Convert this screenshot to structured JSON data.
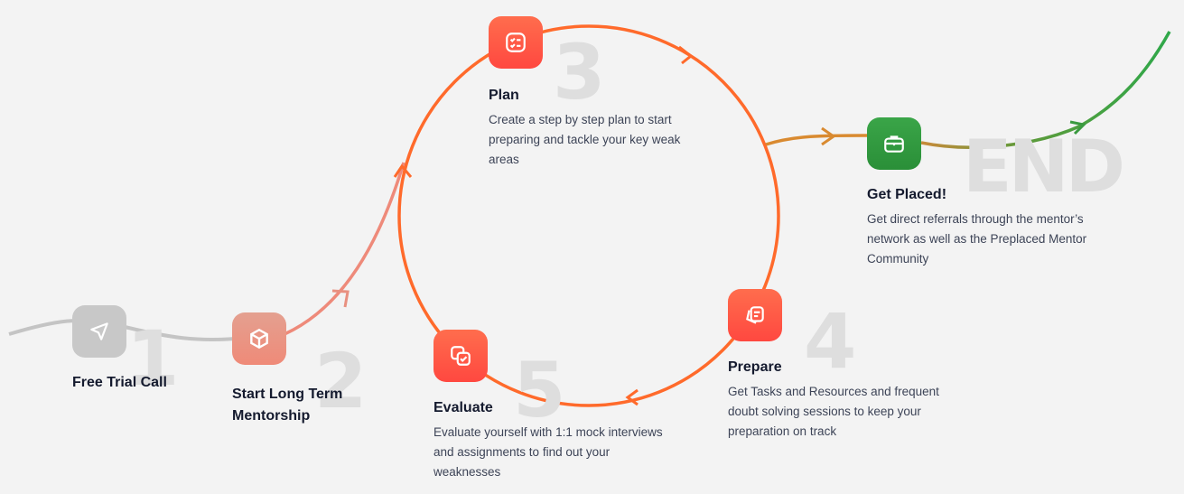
{
  "colors": {
    "grey": "#c4c4c4",
    "salmon": "#ee8a7a",
    "red": "#ff5241",
    "orange": "#ff6a2b",
    "green": "#2f9a3c"
  },
  "steps": [
    {
      "number": "1",
      "title": "Free Trial Call",
      "icon": "paper-plane-icon"
    },
    {
      "number": "2",
      "title": "Start Long Term Mentorship",
      "icon": "cube-icon"
    },
    {
      "number": "3",
      "title": "Plan",
      "desc": "Create a step by step plan to start preparing and tackle your key weak areas",
      "icon": "checklist-icon"
    },
    {
      "number": "4",
      "title": "Prepare",
      "desc": "Get Tasks and Resources and frequent doubt solving sessions to keep your preparation on track",
      "icon": "cards-icon"
    },
    {
      "number": "5",
      "title": "Evaluate",
      "desc": "Evaluate yourself with 1:1 mock interviews and assignments to find out your weaknesses",
      "icon": "copy-check-icon"
    }
  ],
  "end": {
    "label": "END",
    "title": "Get Placed!",
    "desc": "Get direct referrals through the mentor’s network as well as the Preplaced Mentor Community",
    "icon": "briefcase-icon"
  }
}
